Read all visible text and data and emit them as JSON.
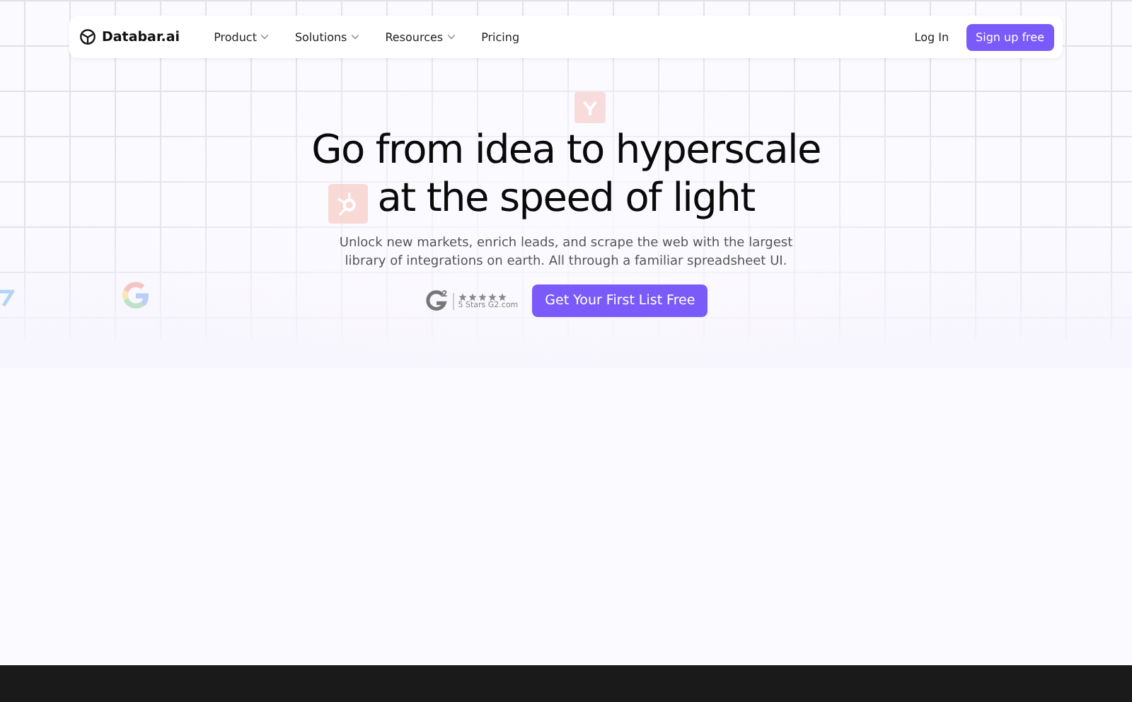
{
  "nav": {
    "brand": "Databar.ai",
    "items": [
      {
        "label": "Product",
        "has_menu": true
      },
      {
        "label": "Solutions",
        "has_menu": true
      },
      {
        "label": "Resources",
        "has_menu": true
      },
      {
        "label": "Pricing",
        "has_menu": false
      }
    ],
    "login": "Log In",
    "signup": "Sign up free"
  },
  "hero": {
    "title_lines": [
      "Go from idea to hyperscale",
      "at the speed of light"
    ],
    "subtitle_lines": [
      "Unlock new markets, enrich leads, and scrape the web with the largest",
      "library of integrations on earth. All through a familiar spreadsheet UI."
    ],
    "rating": {
      "stars": 5,
      "caption": "5 Stars G2.com"
    },
    "cta": "Get Your First List Free"
  }
}
